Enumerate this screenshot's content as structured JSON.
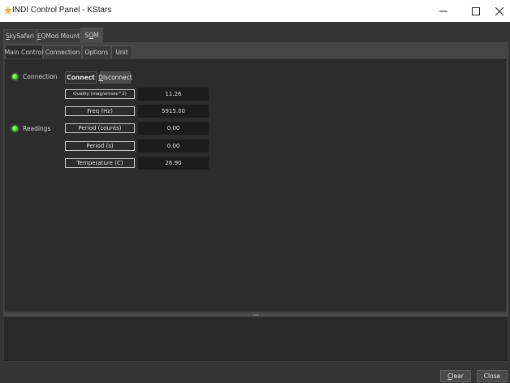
{
  "window": {
    "title": "INDI Control Panel - KStars",
    "minimize_icon": "minimize-icon",
    "maximize_icon": "maximize-icon",
    "close_icon": "close-icon",
    "app_icon": "kstars-app-icon"
  },
  "device_tabs": [
    {
      "key": "S",
      "rest": "kySafari",
      "active": false
    },
    {
      "key": "E",
      "rest": "QMod Mount",
      "active": false
    },
    {
      "pre": "S",
      "key": "Q",
      "rest": "M",
      "active": true
    }
  ],
  "group_tabs": [
    {
      "key": "M",
      "rest": "ain Control",
      "active": true
    },
    {
      "pre": "Conn",
      "key": "e",
      "rest": "ction",
      "active": false
    },
    {
      "key": "O",
      "rest": "ptions",
      "active": false
    },
    {
      "key": "U",
      "rest": "nit",
      "active": false
    }
  ],
  "connection": {
    "label": "Connection",
    "status_color": "#3fcf2a",
    "connect_label": "Connect",
    "disconnect_pre": "",
    "disconnect_key": "D",
    "disconnect_rest": "isconnect"
  },
  "readings": {
    "label": "Readings",
    "status_color": "#3fcf2a",
    "rows": [
      {
        "label": "Quality (mag/arcsec^2)",
        "value": "11.26"
      },
      {
        "label": "Freq (Hz)",
        "value": "5915.00"
      },
      {
        "label": "Period (counts)",
        "value": "0.00"
      },
      {
        "label": "Period (s)",
        "value": "0.00"
      },
      {
        "label": "Temperature (C)",
        "value": "26.90"
      }
    ]
  },
  "footer": {
    "clear_key": "C",
    "clear_rest": "lear",
    "close_label": "Close"
  }
}
